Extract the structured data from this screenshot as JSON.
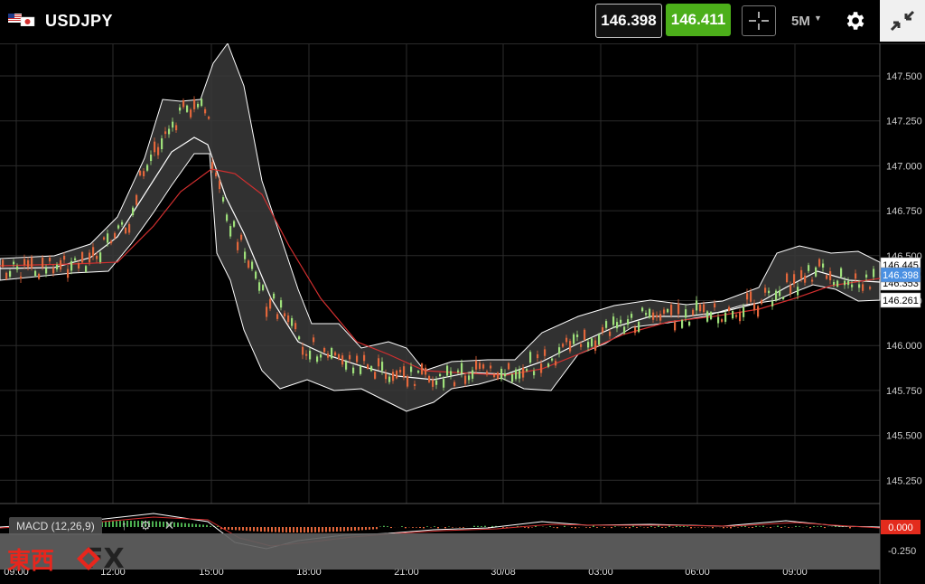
{
  "header": {
    "symbol": "USDJPY",
    "bid": "146.398",
    "ask": "146.411",
    "timeframe": "5M",
    "colors": {
      "ask_bg": "#4caf1a",
      "bid_border": "#bdbdbd",
      "collapse_bg": "#f0f0f0"
    }
  },
  "chart": {
    "price_axis": [
      "147.500",
      "147.250",
      "147.000",
      "146.750",
      "146.500",
      "146.250",
      "146.000",
      "145.750",
      "145.500",
      "145.250"
    ],
    "time_axis": [
      "09:00",
      "12:00",
      "15:00",
      "18:00",
      "21:00",
      "30/08",
      "03:00",
      "06:00",
      "09:00"
    ],
    "price_tags": {
      "upper": "146.445",
      "last": "146.398",
      "middle": "146.353",
      "lower": "146.261"
    },
    "colors": {
      "last_tag": "#4a90e2",
      "ma_line": "#d32f2f",
      "band_line": "#ffffff",
      "band_fill": "#3a3a3a",
      "up_candle": "#9ee07a",
      "down_candle": "#e2663b"
    }
  },
  "macd": {
    "label": "MACD (12,26,9)",
    "axis": [
      "0.000",
      "-0.250"
    ],
    "value_tag": "0.000",
    "colors": {
      "value_tag": "#e32b1d"
    }
  },
  "brand": {
    "kanji": "東西",
    "fx": "FX"
  }
}
